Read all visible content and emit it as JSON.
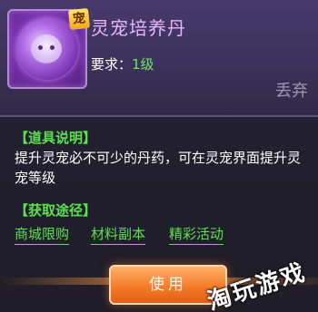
{
  "item": {
    "name": "灵宠培养丹",
    "badge": "宠",
    "requirement_label": "要求：",
    "requirement_value": "1级"
  },
  "discard_label": "丢弃",
  "description": {
    "title": "【道具说明】",
    "text": "提升灵宠必不可少的丹药，可在灵宠界面提升灵宠等级"
  },
  "sources": {
    "title": "【获取途径】",
    "links": [
      "商城限购",
      "材料副本",
      "精彩活动"
    ]
  },
  "use_button": "使用",
  "watermark": "淘玩游戏"
}
